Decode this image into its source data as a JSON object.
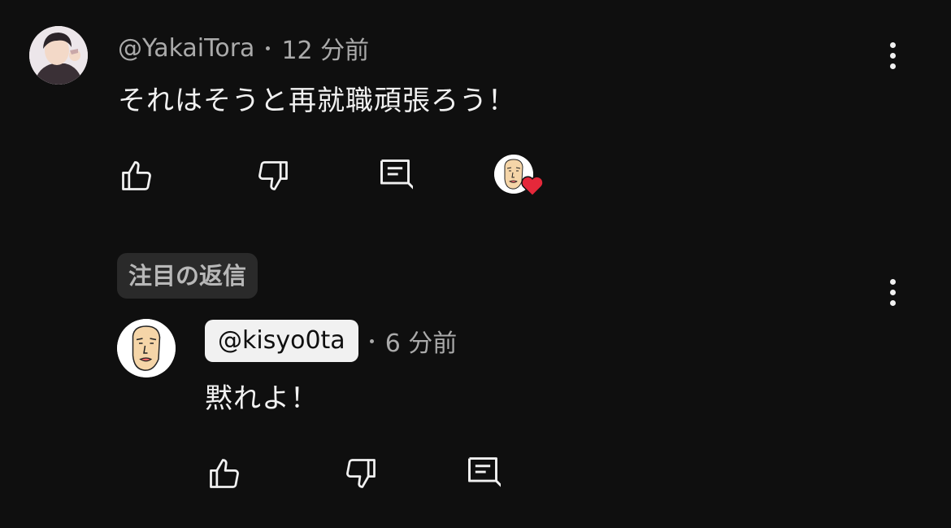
{
  "comment": {
    "author": "@YakaiTora",
    "time": "12 分前",
    "text": "それはそうと再就職頑張ろう！",
    "actions": {
      "like_icon": "thumb-up-icon",
      "dislike_icon": "thumb-down-icon",
      "reply_icon": "reply-icon",
      "hearted_icon": "creator-heart-icon"
    }
  },
  "pinned_label": "注目の返信",
  "reply": {
    "author": "@kisyo0ta",
    "time": "6 分前",
    "text": "黙れよ！",
    "actions": {
      "like_icon": "thumb-up-icon",
      "dislike_icon": "thumb-down-icon",
      "reply_icon": "reply-icon"
    }
  },
  "colors": {
    "background": "#0f0f0f",
    "text_primary": "#f1f1f1",
    "text_secondary": "#aaaaaa",
    "heart": "#e5283a",
    "badge_bg": "#2a2a2a"
  }
}
